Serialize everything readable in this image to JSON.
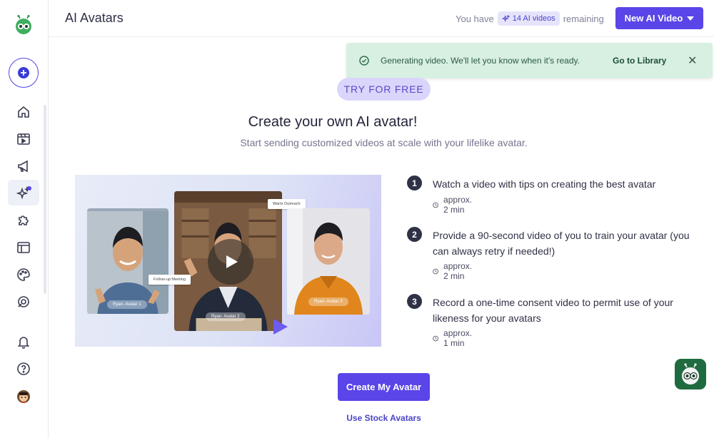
{
  "header": {
    "title": "AI Avatars",
    "credits_prefix": "You have",
    "credits_badge": "14 AI videos",
    "credits_suffix": "remaining",
    "new_video_label": "New AI Video"
  },
  "toast": {
    "message": "Generating video. We'll let you know when it's ready.",
    "action": "Go to Library",
    "close": "✕"
  },
  "main": {
    "badge": "TRY FOR FREE",
    "title": "Create your own AI avatar!",
    "subtitle": "Start sending customized videos at scale with your lifelike avatar.",
    "illustration": {
      "card_labels": [
        "Ryan- Avatar 1",
        "Ryan- Avatar 2",
        "Ryan- Avatar 3"
      ],
      "chip_follow_up": "Follow-up Meeting",
      "chip_outreach": "Warm Outreach"
    },
    "steps": [
      {
        "number": "1",
        "text": "Watch a video with tips on creating the best avatar",
        "time": "approx. 2 min"
      },
      {
        "number": "2",
        "text": "Provide a 90-second video of you to train your avatar (you can always retry if needed!)",
        "time": "approx. 2 min"
      },
      {
        "number": "3",
        "text": "Record a one-time consent video to permit use of your likeness for your avatars",
        "time": "approx. 1 min"
      }
    ],
    "cta_label": "Create My Avatar",
    "stock_link": "Use Stock Avatars"
  },
  "sidebar": {
    "items": [
      "home-icon",
      "video-library-icon",
      "megaphone-icon",
      "sparkles-icon",
      "puzzle-icon",
      "layout-icon",
      "palette-icon",
      "support-icon",
      "bell-icon",
      "help-icon",
      "avatar"
    ]
  },
  "colors": {
    "accent": "#5a45e8",
    "toast_bg": "#d7f0e2",
    "badge_bg": "#dad6fb",
    "bot_bg": "#1f6b3f"
  }
}
